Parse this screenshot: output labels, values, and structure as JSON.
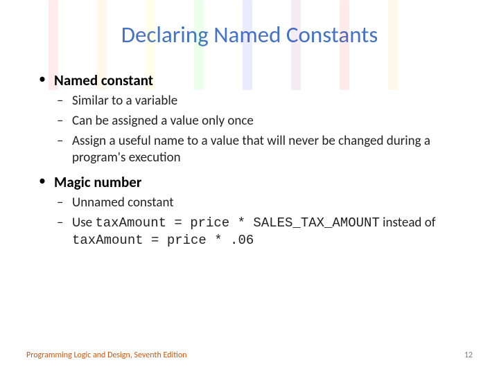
{
  "title": "Declaring Named Constants",
  "bullets": [
    {
      "label": "Named constant",
      "sub": [
        {
          "text": "Similar to a variable"
        },
        {
          "text": "Can be assigned a value only once"
        },
        {
          "text": "Assign a useful name to a value that will never be changed during a program's execution"
        }
      ]
    },
    {
      "label": "Magic number",
      "sub": [
        {
          "text": "Unnamed constant"
        },
        {
          "prefix": "Use ",
          "code1": "taxAmount = price * SALES_TAX_AMOUNT",
          "middle": " instead of ",
          "code2": "taxAmount = price * .06"
        }
      ]
    }
  ],
  "footer": {
    "left": "Programming Logic and Design, Seventh Edition",
    "page": "12"
  },
  "bg_colors": [
    "#ff0000",
    "#ffa500",
    "#ffff00",
    "#00ff00",
    "#0000ff",
    "#800080",
    "#ff0000",
    "#ffa500"
  ]
}
